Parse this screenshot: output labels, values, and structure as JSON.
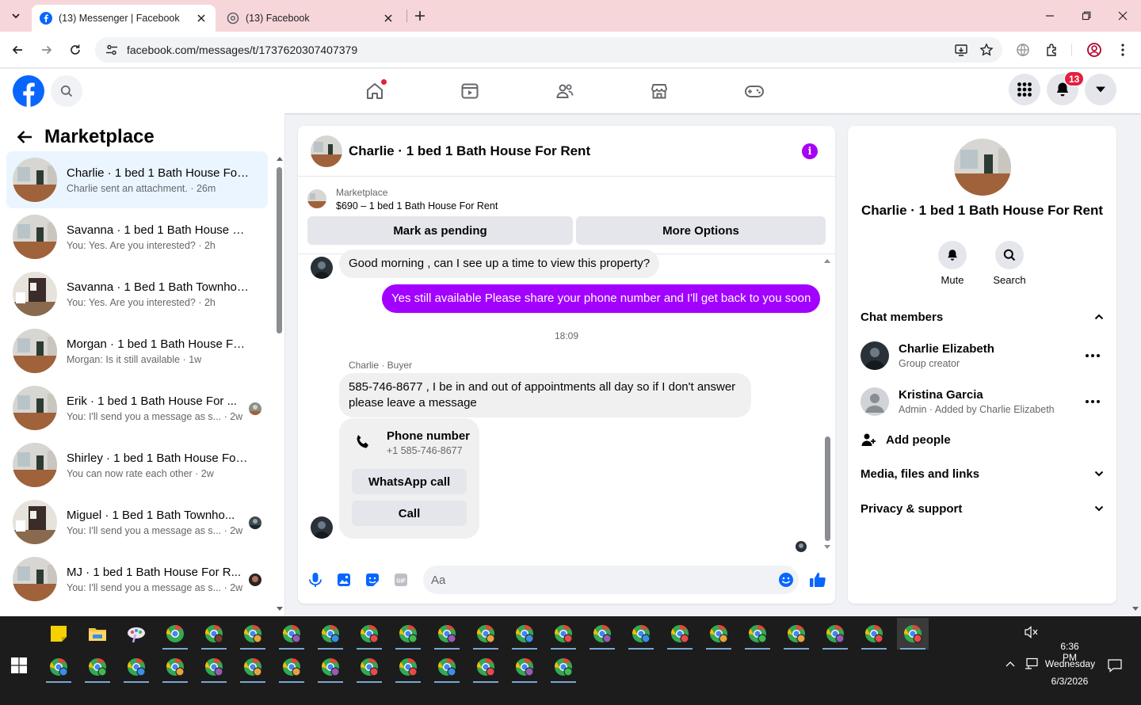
{
  "browser": {
    "tabs": [
      {
        "title": "(13) Messenger | Facebook",
        "active": true
      },
      {
        "title": "(13) Facebook",
        "active": false
      }
    ],
    "url": "facebook.com/messages/t/1737620307407379"
  },
  "header": {
    "notification_count": "13"
  },
  "sidebar": {
    "title": "Marketplace",
    "conversations": [
      {
        "name": "Charlie · 1 bed 1 Bath House For ...",
        "preview": "Charlie sent an attachment. · 26m",
        "active": true,
        "thumb": "room"
      },
      {
        "name": "Savanna · 1 bed 1 Bath House Fo...",
        "preview": "You: Yes. Are you interested? · 2h",
        "thumb": "room"
      },
      {
        "name": "Savanna · 1 Bed 1 Bath Townhouse",
        "preview": "You: Yes. Are you interested? · 2h",
        "thumb": "kitchen"
      },
      {
        "name": "Morgan · 1 bed 1 Bath House For...",
        "preview": "Morgan: Is it still available · 1w",
        "thumb": "room"
      },
      {
        "name": "Erik · 1 bed 1 Bath House For ...",
        "preview": "You: I'll send you a message as s... · 2w",
        "thumb": "room",
        "seen": true
      },
      {
        "name": "Shirley · 1 bed 1 Bath House For ...",
        "preview": "You can now rate each other · 2w",
        "thumb": "room"
      },
      {
        "name": "Miguel · 1 Bed 1 Bath Townho...",
        "preview": "You: I'll send you a message as s... · 2w",
        "thumb": "kitchen",
        "seen": true
      },
      {
        "name": "MJ · 1 bed 1 Bath House For R...",
        "preview": "You: I'll send you a message as s... · 2w",
        "thumb": "room",
        "seen": true
      }
    ]
  },
  "chat": {
    "title": "Charlie · 1 bed 1 Bath House For Rent",
    "listing": {
      "label": "Marketplace",
      "detail": "$690 – 1 bed 1 Bath House For Rent",
      "mark_pending": "Mark as pending",
      "more_options": "More Options"
    },
    "messages": {
      "incoming_1": "Good morning ,  can I see up a time to view this property?",
      "outgoing_1": "Yes still available Please share your phone number and I'll get back to you soon",
      "time": "18:09",
      "sender": "Charlie · Buyer",
      "incoming_2": "585-746-8677  , I be in and out of appointments all day so if I don't answer please leave a message",
      "phone_card": {
        "title": "Phone number",
        "number": "+1 585-746-8677",
        "whatsapp": "WhatsApp call",
        "call": "Call"
      }
    },
    "composer_placeholder": "Aa"
  },
  "info": {
    "title": "Charlie · 1 bed 1 Bath House For Rent",
    "actions": {
      "mute": "Mute",
      "search": "Search"
    },
    "chat_members_label": "Chat members",
    "members": [
      {
        "name": "Charlie Elizabeth",
        "role": "Group creator"
      },
      {
        "name": "Kristina Garcia",
        "role": "Admin · Added by Charlie Elizabeth"
      }
    ],
    "add_people": "Add people",
    "media_label": "Media, files and links",
    "privacy_label": "Privacy & support"
  },
  "taskbar": {
    "time": "6:36 PM",
    "day": "Wednesday",
    "date": "6/3/2026"
  },
  "colors": {
    "facebook_blue": "#0866ff",
    "messenger_purple": "#a200ff",
    "badge_red": "#e41e3f",
    "tab_strip": "#f7d6da"
  }
}
